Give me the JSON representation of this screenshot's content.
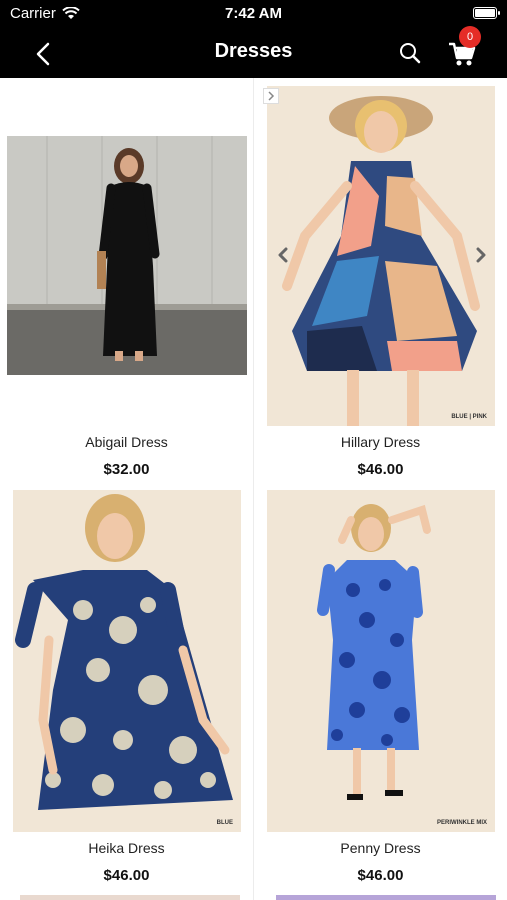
{
  "status": {
    "carrier": "Carrier",
    "time": "7:42 AM"
  },
  "nav": {
    "title": "Dresses",
    "cart_count": "0"
  },
  "products": [
    {
      "name": "Abigail Dress",
      "price": "$32.00"
    },
    {
      "name": "Hillary Dress",
      "price": "$46.00",
      "variant_caption": "BLUE | PINK"
    },
    {
      "name": "Heika Dress",
      "price": "$46.00",
      "variant_caption": "BLUE"
    },
    {
      "name": "Penny Dress",
      "price": "$46.00",
      "variant_caption": "PERIWINKLE MIX"
    }
  ]
}
